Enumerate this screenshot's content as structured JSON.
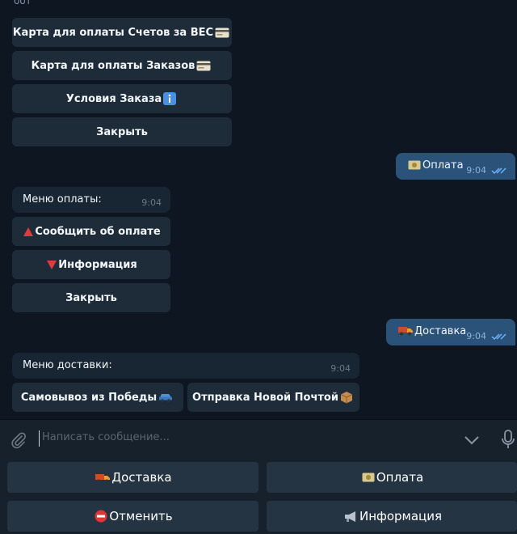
{
  "header": {
    "bot_label": "бот"
  },
  "messages": {
    "menu1": {
      "buttons": [
        "Карта для оплаты Счетов за ВЕС",
        "Карта для оплаты Заказов",
        "Условия Заказа",
        "Закрыть"
      ],
      "button_icons": [
        "card-icon",
        "card-icon",
        "info-icon",
        ""
      ]
    },
    "out1": {
      "text": "Оплата",
      "icon": "money-icon",
      "time": "9:04"
    },
    "menu_payment": {
      "title": "Меню оплаты:",
      "time": "9:04",
      "buttons": [
        "Сообщить об оплате",
        "Информация",
        "Закрыть"
      ],
      "button_icons": [
        "red-triangle-up-icon",
        "red-triangle-down-icon",
        ""
      ]
    },
    "out2": {
      "text": "Доставка",
      "icon": "truck-icon",
      "time": "9:04"
    },
    "menu_delivery": {
      "title": "Меню доставки:",
      "time": "9:04",
      "buttons": [
        "Самовывоз из Победы",
        "Отправка Новой Почтой"
      ],
      "button_icons": [
        "car-icon",
        "package-icon"
      ]
    }
  },
  "composer": {
    "placeholder": "Написать сообщение..."
  },
  "keyboard": {
    "buttons": [
      "Доставка",
      "Оплата",
      "Отменить",
      "Информация"
    ],
    "icons": [
      "truck-icon",
      "money-icon",
      "no-entry-icon",
      "megaphone-icon"
    ]
  },
  "colors": {
    "bg": "#0e1621",
    "incoming": "#182533",
    "outgoing": "#2b5278",
    "button": "#1e2c3a",
    "panel": "#17212b"
  }
}
